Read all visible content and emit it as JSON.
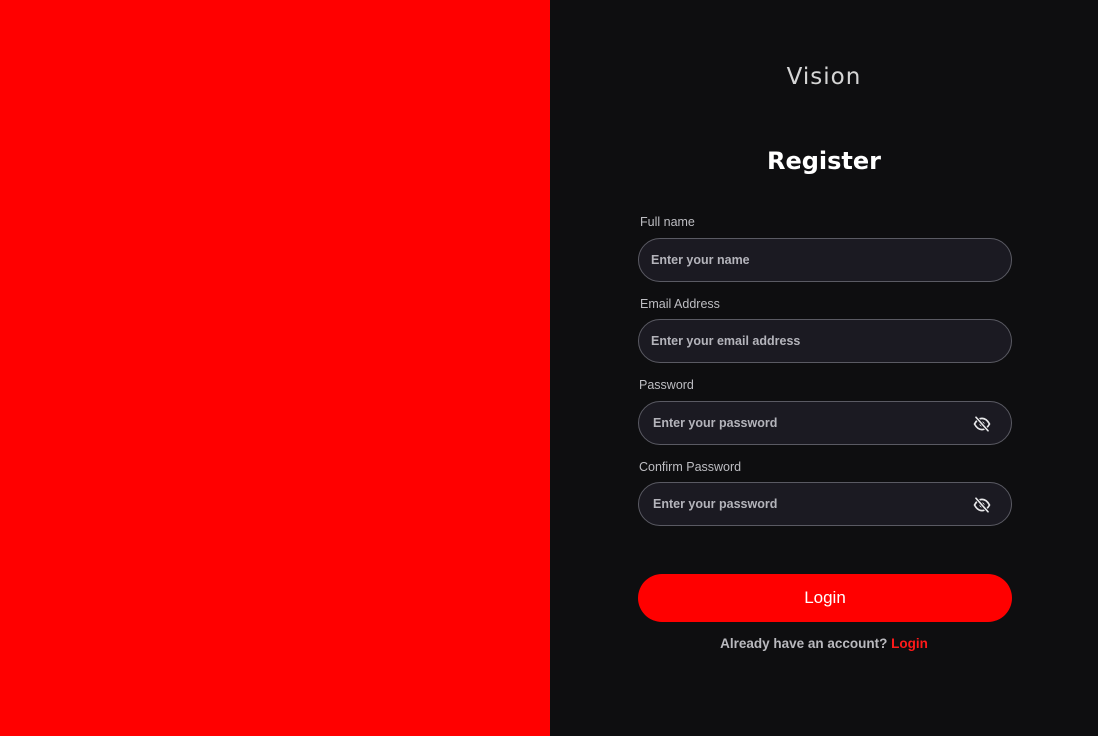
{
  "brand": {
    "name": "Vision"
  },
  "form": {
    "title": "Register",
    "fields": [
      {
        "label": "Full name",
        "placeholder": "Enter your name"
      },
      {
        "label": "Email Address",
        "placeholder": "Enter your email address"
      },
      {
        "label": "Password",
        "placeholder": "Enter your password",
        "icon": "eye-off-icon"
      },
      {
        "label": "Confirm Password",
        "placeholder": "Enter your password",
        "icon": "eye-off-icon"
      }
    ],
    "submit_label": "Login"
  },
  "footer": {
    "prompt": "Already have an account?",
    "link_label": "Login"
  },
  "colors": {
    "accent": "#ff0000",
    "panel_dark": "#0e0e10",
    "field_bg": "#1b1a22"
  }
}
